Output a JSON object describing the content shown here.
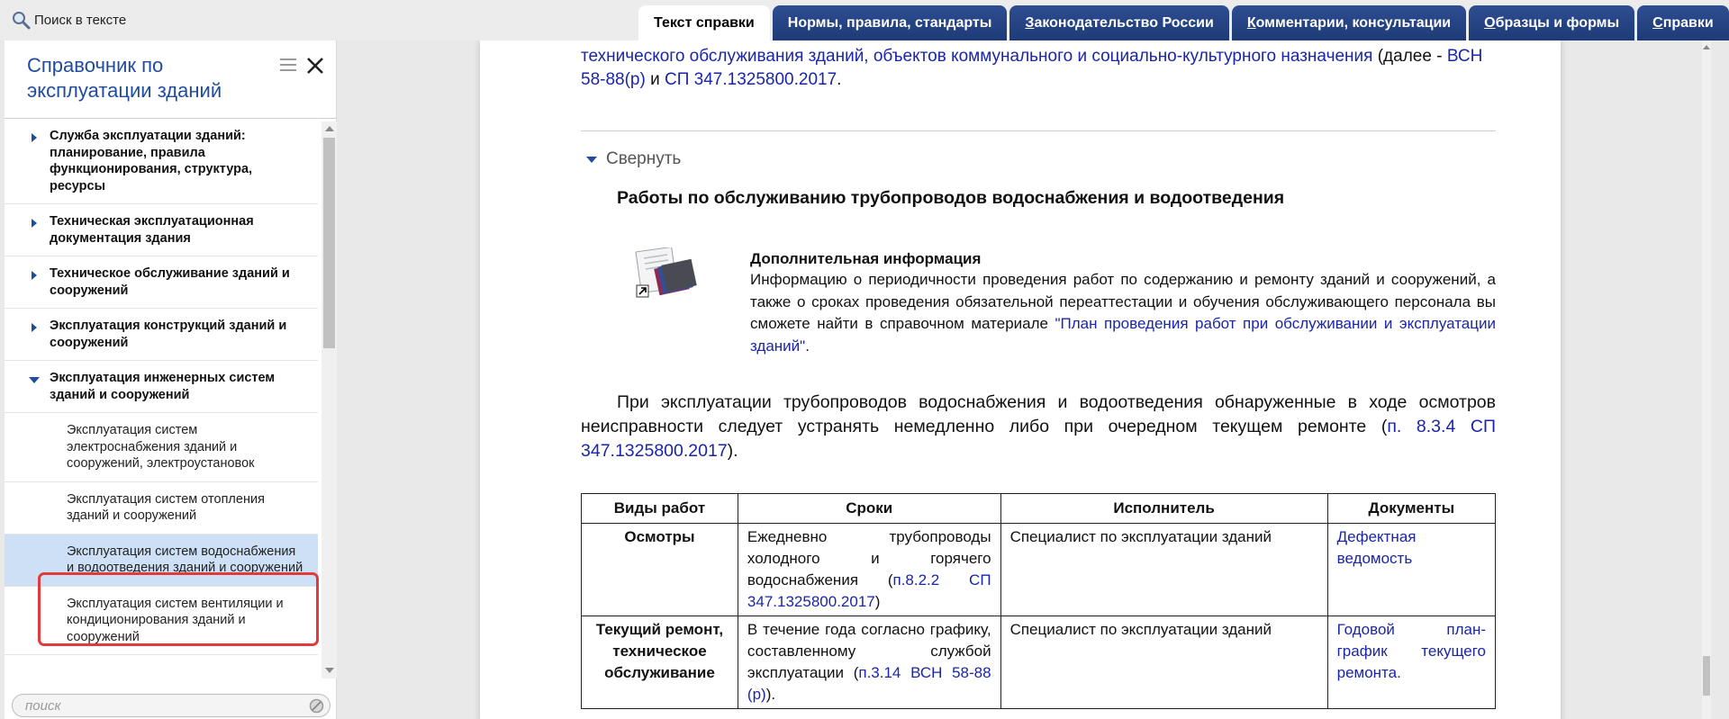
{
  "topbar": {
    "search_label": "Поиск в тексте",
    "search_icon": "magnifier-icon",
    "tabs": [
      {
        "label": "Текст справки",
        "active": true
      },
      {
        "label": "Нормы, правила, стандарты"
      },
      {
        "label_u": "З",
        "label": "аконодательство России"
      },
      {
        "label_u": "К",
        "label": "омментарии, консультации"
      },
      {
        "label_u": "О",
        "label": "бразцы и формы"
      },
      {
        "label_u": "С",
        "label": "правки"
      }
    ]
  },
  "sidebar": {
    "title": "Справочник по эксплуатации зданий",
    "items": [
      {
        "label": "Служба эксплуатации зданий: планирование, правила функционирования, структура, ресурсы"
      },
      {
        "label": "Техническая эксплуатационная документация здания"
      },
      {
        "label": "Техническое обслуживание зданий и сооружений"
      },
      {
        "label": "Эксплуатация конструкций зданий и сооружений"
      },
      {
        "label": "Эксплуатация инженерных систем зданий и сооружений"
      },
      {
        "label": "Эксплуатация систем электроснабжения зданий и сооружений, электроустановок"
      },
      {
        "label": "Эксплуатация систем отопления зданий и сооружений"
      },
      {
        "label": "Эксплуатация систем водоснабжения и водоотведения зданий и сооружений"
      },
      {
        "label": "Эксплуатация систем вентиляции и кондиционирования зданий и сооружений"
      }
    ],
    "search_placeholder": "поиск"
  },
  "document": {
    "intro": {
      "link1": "технического обслуживания зданий, объектов коммунального и социально-культурного назначения",
      "text1": " (далее - ",
      "link2": "ВСН 58-88(р)",
      "text2": " и ",
      "link3": "СП 347.1325800.2017",
      "text3": "."
    },
    "collapse_label": "Свернуть",
    "section_title": "Работы по обслуживанию трубопроводов водоснабжения и водоотведения",
    "info": {
      "title": "Дополнительная информация",
      "text": "Информацию о периодичности проведения работ по содержанию и ремонту зданий и сооружений, а также о сроках проведения обязательной переаттестации и обучения обслуживающего персонала вы сможете найти в справочном материале ",
      "link": "\"План проведения работ при обслуживании и эксплуатации зданий\"",
      "tail": "."
    },
    "paragraph": {
      "text": "При эксплуатации трубопроводов водоснабжения и водоотведения обнаруженные в ходе осмотров неисправности следует устранять немедленно либо при очередном текущем ремонте (",
      "link": "п. 8.3.4 СП 347.1325800.2017",
      "tail": ")."
    },
    "table": {
      "headers": [
        "Виды работ",
        "Сроки",
        "Исполнитель",
        "Документы"
      ],
      "rows": [
        {
          "kind": "Осмотры",
          "term": "Ежедневно трубопроводы холодного и горячего водоснабжения (",
          "term_link": "п.8.2.2 СП 347.1325800.2017",
          "term_tail": ")",
          "executor": "Специалист по эксплуатации зданий",
          "docs": "Дефектная ведомость"
        },
        {
          "kind": "Текущий ремонт, техническое обслуживание",
          "term": "В течение года согласно графику, составленному службой эксплуатации (",
          "term_link": "п.3.14 ВСН 58-88 (р)",
          "term_tail": ").",
          "executor": "Специалист по эксплуатации зданий",
          "docs": "Годовой план-график текущего ремонта."
        }
      ]
    }
  }
}
